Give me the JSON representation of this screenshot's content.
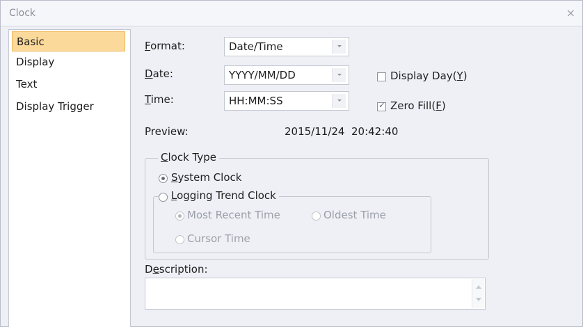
{
  "window": {
    "title": "Clock",
    "close_symbol": "×"
  },
  "sidebar": {
    "items": [
      {
        "label": "Basic",
        "selected": true
      },
      {
        "label": "Display",
        "selected": false
      },
      {
        "label": "Text",
        "selected": false
      },
      {
        "label": "Display Trigger",
        "selected": false
      }
    ]
  },
  "form": {
    "format": {
      "label_key": "F",
      "label_rest": "ormat:",
      "value": "Date/Time"
    },
    "date": {
      "label_key": "D",
      "label_rest": "ate:",
      "value": "YYYY/MM/DD"
    },
    "time": {
      "label_key": "T",
      "label_rest": "ime:",
      "value": "HH:MM:SS"
    },
    "display_day": {
      "label_pre": "Display Day(",
      "label_key": "Y",
      "label_post": ")",
      "checked": false
    },
    "zero_fill": {
      "label_pre": "Zero Fill(",
      "label_key": "F",
      "label_post": ")",
      "checked": true,
      "check_mark": "✓"
    },
    "preview": {
      "label": "Preview:",
      "value": "2015/11/24  20:42:40"
    }
  },
  "clock_type": {
    "legend_key": "C",
    "legend_rest": "lock Type",
    "system_clock": {
      "label_key": "S",
      "label_rest": "ystem Clock",
      "selected": true
    },
    "logging_trend_clock": {
      "label_key": "L",
      "label_rest": "ogging Trend Clock",
      "selected": false,
      "options": {
        "most_recent": {
          "label": "Most Recent Time",
          "selected": true
        },
        "oldest": {
          "label": "Oldest Time",
          "selected": false
        },
        "cursor": {
          "label": "Cursor Time",
          "selected": false
        }
      }
    }
  },
  "description": {
    "label_pre": "D",
    "label_key": "e",
    "label_rest": "scription:",
    "value": ""
  }
}
